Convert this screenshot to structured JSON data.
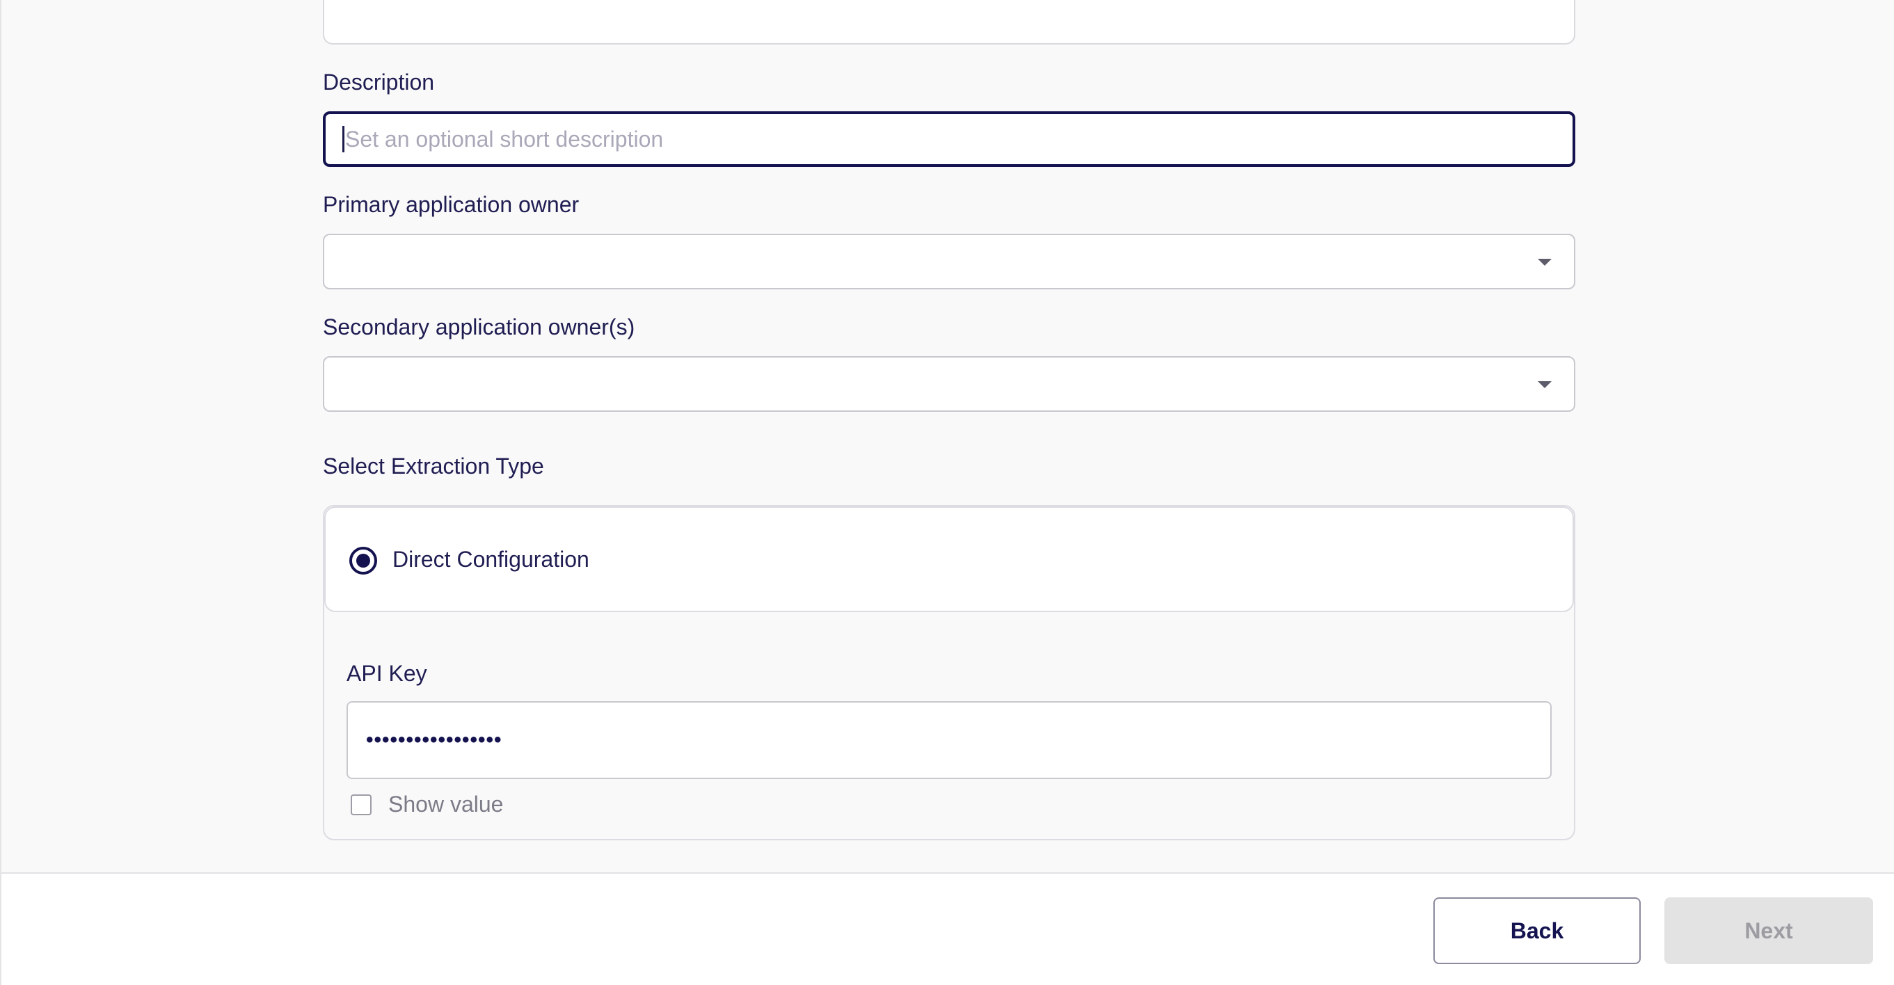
{
  "form": {
    "description": {
      "label": "Description",
      "placeholder": "Set an optional short description",
      "value": ""
    },
    "primary_owner": {
      "label": "Primary application owner",
      "value": ""
    },
    "secondary_owners": {
      "label": "Secondary application owner(s)",
      "value": ""
    },
    "extraction": {
      "label": "Select Extraction Type",
      "selected_option": "Direct Configuration",
      "api_key_label": "API Key",
      "api_key_masked": "•••••••••••••••••",
      "show_value_label": "Show value",
      "show_value_checked": false
    }
  },
  "footer": {
    "back_label": "Back",
    "next_label": "Next",
    "next_enabled": false
  },
  "colors": {
    "primary": "#141350",
    "text": "#1f1d52",
    "disabled_bg": "#e3e3e3",
    "page_bg": "#f9f9f9"
  }
}
